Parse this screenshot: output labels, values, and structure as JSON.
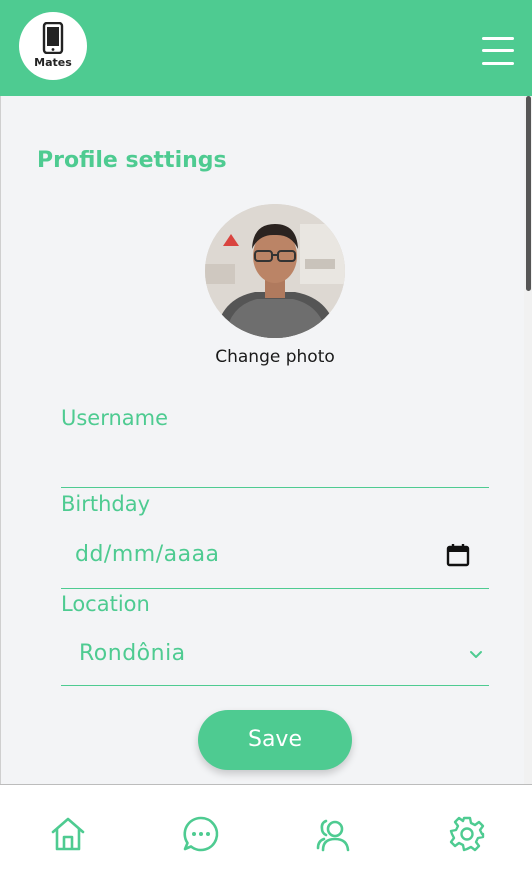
{
  "app": {
    "logo_text": "Mates",
    "brand_color": "#4ecb91"
  },
  "header": {
    "menu_icon": "hamburger-icon"
  },
  "profile": {
    "title": "Profile settings",
    "change_photo_label": "Change photo"
  },
  "form": {
    "username": {
      "label": "Username",
      "value": ""
    },
    "birthday": {
      "label": "Birthday",
      "placeholder": "dd/mm/aaaa",
      "icon": "calendar-icon"
    },
    "location": {
      "label": "Location",
      "selected": "Rondônia",
      "icon": "chevron-down-icon"
    },
    "save_label": "Save"
  },
  "bottom_nav": {
    "items": [
      {
        "name": "home",
        "icon": "home-icon"
      },
      {
        "name": "messages",
        "icon": "chat-icon"
      },
      {
        "name": "friends",
        "icon": "users-icon"
      },
      {
        "name": "settings",
        "icon": "gear-icon"
      }
    ]
  }
}
